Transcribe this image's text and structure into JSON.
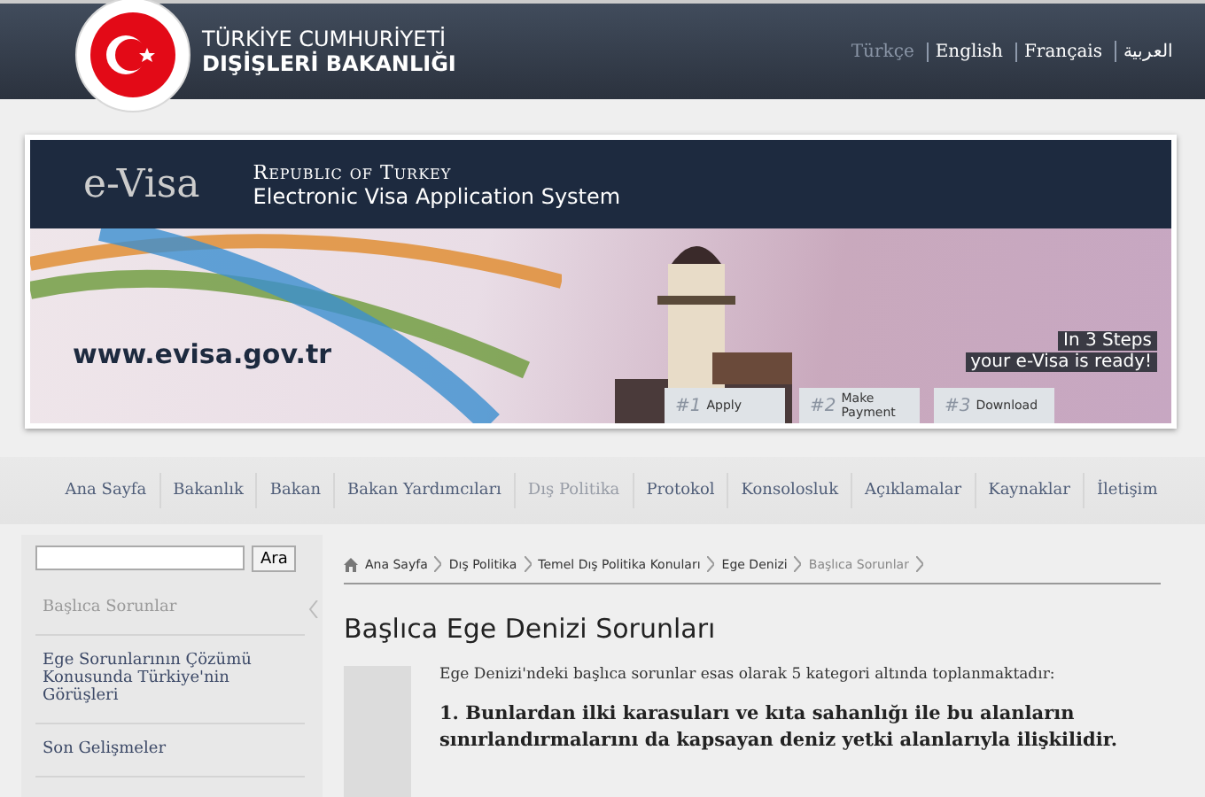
{
  "header": {
    "title_line_1": "TÜRKİYE CUMHURİYETİ",
    "title_line_2": "DIŞİŞLERİ BAKANLIĞI",
    "languages": [
      {
        "label": "Türkçe",
        "selected": true
      },
      {
        "label": "English",
        "selected": false
      },
      {
        "label": "Français",
        "selected": false
      },
      {
        "label": "العربية",
        "selected": false
      }
    ]
  },
  "banner": {
    "logo": "e-Visa",
    "title": "Republic of Turkey",
    "subtitle": "Electronic Visa Application System",
    "url": "www.evisa.gov.tr",
    "tagline_1": "In 3 Steps",
    "tagline_2": "your e-Visa is ready!",
    "steps": [
      {
        "number": "#1",
        "label": "Apply"
      },
      {
        "number": "#2",
        "label": "Make Payment"
      },
      {
        "number": "#3",
        "label": "Download"
      }
    ]
  },
  "nav": [
    {
      "label": "Ana Sayfa",
      "selected": false
    },
    {
      "label": "Bakanlık",
      "selected": false
    },
    {
      "label": "Bakan",
      "selected": false
    },
    {
      "label": "Bakan Yardımcıları",
      "selected": false
    },
    {
      "label": "Dış Politika",
      "selected": true
    },
    {
      "label": "Protokol",
      "selected": false
    },
    {
      "label": "Konsolosluk",
      "selected": false
    },
    {
      "label": "Açıklamalar",
      "selected": false
    },
    {
      "label": "Kaynaklar",
      "selected": false
    },
    {
      "label": "İletişim",
      "selected": false
    }
  ],
  "sidebar": {
    "search_button": "Ara",
    "items": [
      {
        "label": "Başlıca Sorunlar",
        "selected": true
      },
      {
        "label": "Ege Sorunlarının Çözümü Konusunda Türkiye'nin Görüşleri",
        "selected": false
      },
      {
        "label": "Son Gelişmeler",
        "selected": false
      }
    ]
  },
  "breadcrumb": [
    {
      "label": "Ana Sayfa",
      "selected": false
    },
    {
      "label": "Dış Politika",
      "selected": false
    },
    {
      "label": "Temel Dış Politika Konuları",
      "selected": false
    },
    {
      "label": "Ege Denizi",
      "selected": false
    },
    {
      "label": "Başlıca Sorunlar",
      "selected": true
    }
  ],
  "content": {
    "heading": "Başlıca Ege Denizi Sorunları",
    "intro": "Ege Denizi'ndeki başlıca sorunlar esas olarak 5 kategori altında toplanmaktadır:",
    "point_1": "1. Bunlardan ilki karasuları ve kıta sahanlığı ile bu alanların sınırlandırmalarını da kapsayan deniz yetki alanlarıyla ilişkilidir."
  }
}
